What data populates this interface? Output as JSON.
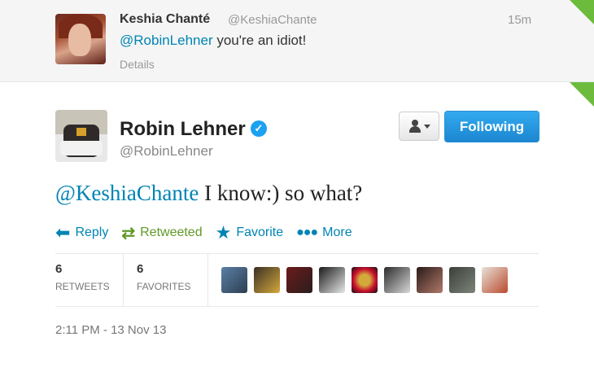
{
  "reply": {
    "name": "Keshia Chanté",
    "handle": "@KeshiaChante",
    "time": "15m",
    "mention": "@RobinLehner",
    "text": " you're an idiot!",
    "details": "Details"
  },
  "tweet": {
    "name": "Robin Lehner",
    "handle": "@RobinLehner",
    "verified": true,
    "follow_label": "Following",
    "mention": "@KeshiaChante",
    "text": " I know:) so what?",
    "actions": {
      "reply": "Reply",
      "retweeted": "Retweeted",
      "favorite": "Favorite",
      "more": "More"
    },
    "stats": {
      "retweets_count": "6",
      "retweets_label": "RETWEETS",
      "favorites_count": "6",
      "favorites_label": "FAVORITES"
    },
    "timestamp": "2:11 PM - 13 Nov 13"
  },
  "colors": {
    "link": "#0084b4",
    "retweeted": "#609928",
    "follow_button": "#1c86d1",
    "corner": "#6cbb3c"
  },
  "icons": {
    "verified": "verified-badge-icon",
    "user_menu": "person-icon",
    "reply": "reply-arrow-icon",
    "retweet": "retweet-icon",
    "favorite": "star-icon",
    "more": "dots-icon"
  }
}
